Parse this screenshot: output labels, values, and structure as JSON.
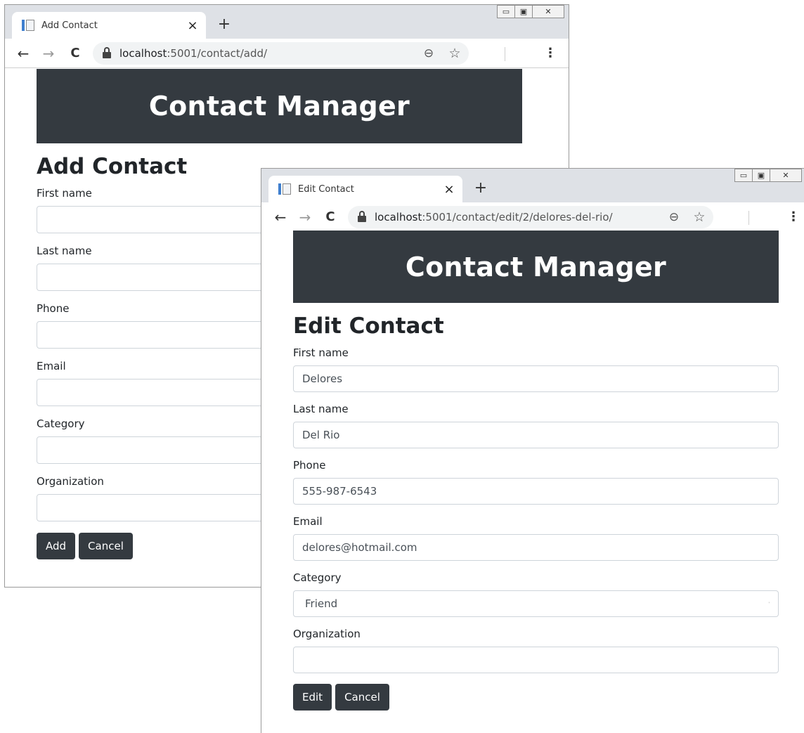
{
  "windows": [
    {
      "tab_title": "Add Contact",
      "url_host": "localhost",
      "url_path": ":5001/contact/add/",
      "banner": "Contact Manager",
      "heading": "Add Contact",
      "fields": [
        {
          "label": "First name",
          "value": ""
        },
        {
          "label": "Last name",
          "value": ""
        },
        {
          "label": "Phone",
          "value": ""
        },
        {
          "label": "Email",
          "value": ""
        },
        {
          "label": "Category",
          "value": ""
        },
        {
          "label": "Organization",
          "value": ""
        }
      ],
      "primary_button": "Add",
      "cancel_button": "Cancel"
    },
    {
      "tab_title": "Edit Contact",
      "url_host": "localhost",
      "url_path": ":5001/contact/edit/2/delores-del-rio/",
      "banner": "Contact Manager",
      "heading": "Edit Contact",
      "fields": [
        {
          "label": "First name",
          "value": "Delores"
        },
        {
          "label": "Last name",
          "value": "Del Rio"
        },
        {
          "label": "Phone",
          "value": "555-987-6543"
        },
        {
          "label": "Email",
          "value": "delores@hotmail.com"
        },
        {
          "label": "Category",
          "value": "Friend"
        },
        {
          "label": "Organization",
          "value": ""
        }
      ],
      "primary_button": "Edit",
      "cancel_button": "Cancel"
    }
  ],
  "icons": {
    "back": "←",
    "forward": "→",
    "reload": "C",
    "zoom": "⊖",
    "star": "☆",
    "menu": "⋮",
    "close_tab": "×",
    "new_tab": "+",
    "minimize": "▭",
    "maximize": "▣",
    "close_window": "✕"
  },
  "colors": {
    "banner_bg": "#343a40",
    "button_bg": "#343a40",
    "tabstrip_bg": "#dee1e6",
    "omnibox_bg": "#f1f3f4"
  }
}
